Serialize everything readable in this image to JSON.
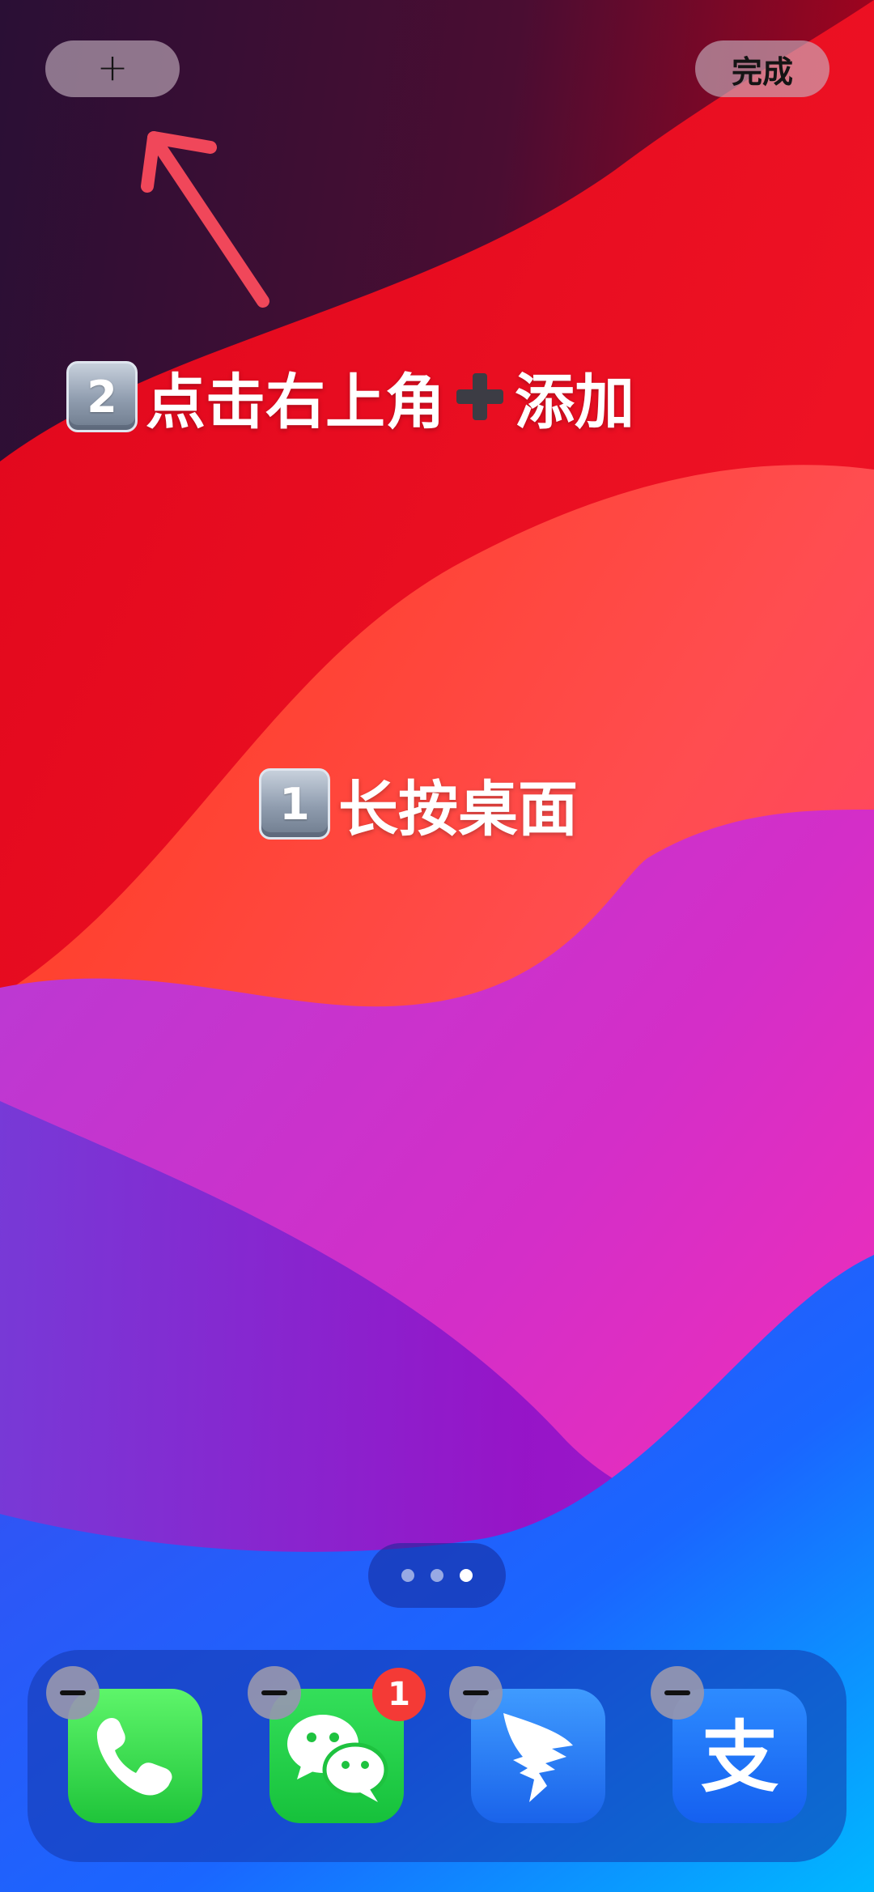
{
  "top_bar": {
    "add_button_label": "+",
    "done_button_label": "完成"
  },
  "annotations": {
    "step2": {
      "number": "2",
      "text_before": "点击右上角",
      "text_after": "添加"
    },
    "step1": {
      "number": "1",
      "text": "长按桌面"
    },
    "arrow_color": "#f0475a"
  },
  "page_indicator": {
    "count": 3,
    "active_index": 2
  },
  "dock": {
    "apps": [
      {
        "name": "phone",
        "icon": "phone-icon"
      },
      {
        "name": "wechat",
        "icon": "wechat-icon",
        "badge": "1"
      },
      {
        "name": "dingtalk",
        "icon": "bird-wing-icon"
      },
      {
        "name": "alipay",
        "icon": "alipay-icon",
        "glyph": "支"
      }
    ]
  },
  "colors": {
    "badge": "#f43a36",
    "phone_green": "#28cc3f",
    "wechat_green": "#1ec23f",
    "app_blue": "#1a63ea"
  }
}
